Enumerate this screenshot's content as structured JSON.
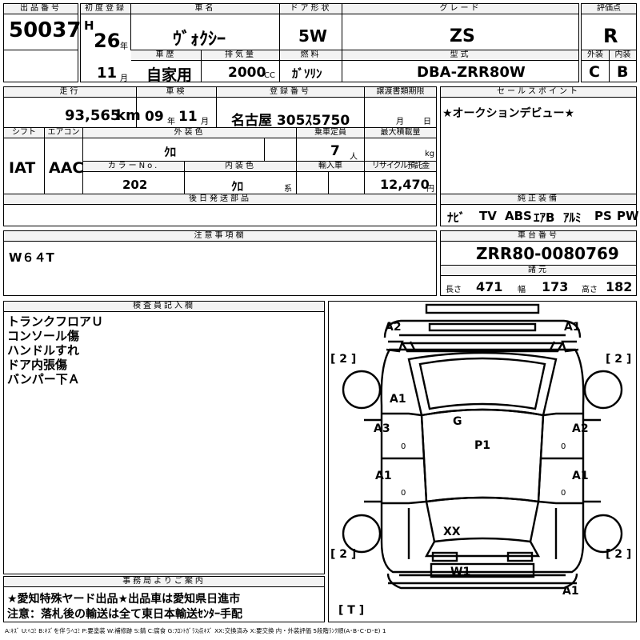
{
  "header": {
    "lot_label": "出品番号",
    "lot": "50037",
    "first_reg_label": "初度登録",
    "era": "H",
    "year": "26",
    "year_unit": "年",
    "month": "11",
    "month_unit": "月",
    "car_name_label": "車名",
    "car_name": "ｳﾞｫｸｼｰ",
    "door_label": "ドア形状",
    "door": "5W",
    "grade_label": "グレード",
    "grade": "ZS",
    "score_label": "評価点",
    "score": "R",
    "history_label": "車歴",
    "history": "自家用",
    "displacement_label": "排気量",
    "displacement": "2000",
    "displacement_unit": "CC",
    "fuel_label": "燃料",
    "fuel": "ｶﾞｿﾘﾝ",
    "model_label": "型式",
    "model": "DBA-ZRR80W",
    "ext_label": "外装",
    "ext": "C",
    "int_label": "内装",
    "int": "B"
  },
  "row2": {
    "mileage_label": "走行",
    "mileage": "93,565",
    "mileage_unit": "km",
    "inspection_label": "車検",
    "inspection_year": "09",
    "inspection_year_unit": "年",
    "inspection_month": "11",
    "inspection_month_unit": "月",
    "plate_label": "登録番号",
    "plate": "名古屋 305ｽ5750",
    "transfer_label": "譲渡書類期限",
    "transfer_month_unit": "月",
    "transfer_day_unit": "日",
    "shift_label": "シフト",
    "shift": "IAT",
    "ac_label": "エアコン",
    "ac": "AAC",
    "ext_color_label": "外装色",
    "ext_color": "ｸﾛ",
    "capacity_label": "乗車定員",
    "capacity": "7",
    "capacity_unit": "人",
    "max_load_label": "最大積載量",
    "max_load_unit": "kg",
    "color_no_label": "カラーNo.",
    "color_no": "202",
    "int_color_label": "内装色",
    "int_color": "ｸﾛ",
    "int_color_unit": "系",
    "import_label": "輸入車",
    "recycle_label": "リサイクル預託金",
    "recycle": "12,470",
    "recycle_unit": "円",
    "later_parts_label": "後日発送部品"
  },
  "sales_point": {
    "label": "セールスポイント",
    "text": "★オークションデビュー★"
  },
  "equipment": {
    "label": "純正装備",
    "items": [
      "ﾅﾋﾞ",
      "TV",
      "ABS",
      "ｴｱB",
      "ｱﾙﾐ",
      "PS",
      "PW"
    ]
  },
  "caution": {
    "label": "注意事項欄",
    "text": "W６４T"
  },
  "chassis": {
    "label": "車台番号",
    "value": "ZRR80-0080769"
  },
  "dims": {
    "label": "諸元",
    "length_label": "長さ",
    "length": "471",
    "width_label": "幅",
    "width": "173",
    "height_label": "高さ",
    "height": "182"
  },
  "inspector": {
    "label": "検査員記入欄",
    "lines": [
      "トランクフロアＵ",
      "コンソール傷",
      "ハンドルすれ",
      "ドア内張傷",
      "バンパー下Ａ"
    ]
  },
  "office": {
    "label": "事務局よりご案内",
    "lines": [
      "★愛知特殊ヤード出品★出品車は愛知県日進市",
      "注意：落札後の輸送は全て東日本輸送ｾﾝﾀｰ手配"
    ]
  },
  "diagram": {
    "marks": {
      "front_left": "A2",
      "front_right": "A1",
      "fender_left": "A1",
      "roof": "G",
      "center": "P1",
      "door_fl": "A3",
      "door_fr": "A2",
      "door_fl_sub": "0",
      "door_fr_sub": "0",
      "door_rl": "A1",
      "door_rr": "A1",
      "door_rl_sub": "0",
      "door_rr_sub": "0",
      "rear": "XX",
      "rear_window": "W1",
      "rear_bumper": "A1"
    },
    "tires": {
      "fl": "[ 2 ]",
      "fr": "[ 2 ]",
      "rl": "[ 2 ]",
      "rr": "[ 2 ]",
      "spare": "[ T ]"
    }
  },
  "legend": "A:ｷｽﾞ U:ﾍｺﾐ B:ｷｽﾞを伴うﾍｺﾐ P:要塗装 W:補修跡 S:錆 C:腐食 G:ﾌﾛﾝﾄｶﾞﾗｽ点ｷｽﾞ XX:交換済み X:要交換 内・外装評価 5段階ﾗﾝｸ順(A･B･C･D･E) 1"
}
